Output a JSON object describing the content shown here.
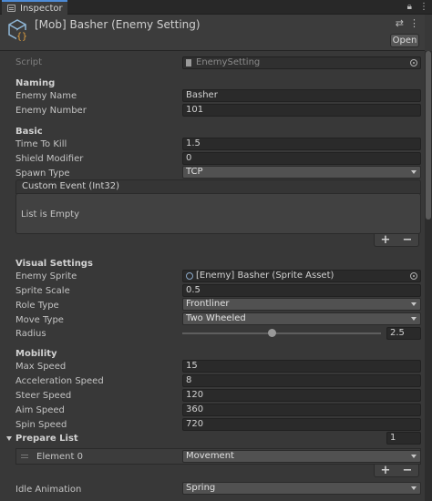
{
  "tab": {
    "label": "Inspector"
  },
  "header": {
    "title": "[Mob] Basher (Enemy Setting)",
    "open_label": "Open"
  },
  "script": {
    "label": "Script",
    "value": "EnemySetting"
  },
  "naming": {
    "title": "Naming",
    "enemy_name_label": "Enemy Name",
    "enemy_name_value": "Basher",
    "enemy_number_label": "Enemy Number",
    "enemy_number_value": "101"
  },
  "basic": {
    "title": "Basic",
    "time_to_kill_label": "Time To Kill",
    "time_to_kill_value": "1.5",
    "shield_modifier_label": "Shield Modifier",
    "shield_modifier_value": "0",
    "spawn_type_label": "Spawn Type",
    "spawn_type_value": "TCP",
    "custom_event_label": "Custom Event (Int32)",
    "custom_event_empty": "List is Empty"
  },
  "visual": {
    "title": "Visual Settings",
    "enemy_sprite_label": "Enemy Sprite",
    "enemy_sprite_value": "[Enemy] Basher (Sprite Asset)",
    "sprite_scale_label": "Sprite Scale",
    "sprite_scale_value": "0.5",
    "role_type_label": "Role Type",
    "role_type_value": "Frontliner",
    "move_type_label": "Move Type",
    "move_type_value": "Two Wheeled",
    "radius_label": "Radius",
    "radius_value": "2.5",
    "radius_fraction": 0.45
  },
  "mobility": {
    "title": "Mobility",
    "max_speed_label": "Max Speed",
    "max_speed_value": "15",
    "acceleration_label": "Acceleration Speed",
    "acceleration_value": "8",
    "steer_label": "Steer Speed",
    "steer_value": "120",
    "aim_label": "Aim Speed",
    "aim_value": "360",
    "spin_label": "Spin Speed",
    "spin_value": "720"
  },
  "prepare": {
    "title": "Prepare List",
    "count": "1",
    "element_label": "Element 0",
    "element_value": "Movement"
  },
  "idle": {
    "label": "Idle Animation",
    "value": "Spring"
  },
  "list_controls": {
    "plus": "+",
    "minus": "−"
  }
}
